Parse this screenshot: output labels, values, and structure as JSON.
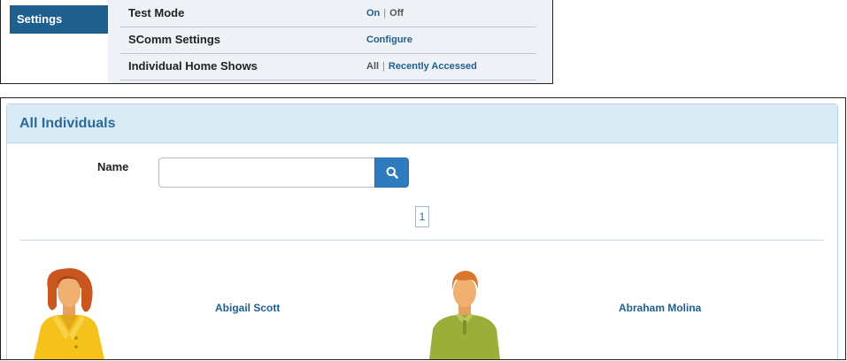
{
  "settings": {
    "tab_label": "Settings",
    "rows": [
      {
        "label": "Test Mode",
        "options": [
          "On",
          "Off"
        ]
      },
      {
        "label": "SComm Settings",
        "options": [
          "Configure"
        ]
      },
      {
        "label": "Individual Home Shows",
        "options": [
          "All",
          "Recently Accessed"
        ]
      }
    ]
  },
  "individuals": {
    "title": "All Individuals",
    "name_label": "Name",
    "search": {
      "value": "",
      "placeholder": ""
    },
    "pagination": [
      "1"
    ],
    "people": [
      {
        "name": "Abigail Scott"
      },
      {
        "name": "Abraham Molina"
      }
    ]
  },
  "colors": {
    "accent": "#1e5f8e",
    "heading_bg": "#d9ecf6",
    "search_button": "#2f7bbf"
  },
  "icons": [
    "search-icon",
    "female-avatar-icon",
    "male-avatar-icon"
  ]
}
